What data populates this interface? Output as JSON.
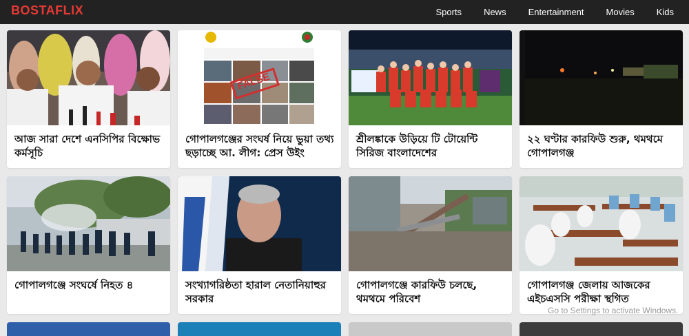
{
  "site": {
    "logo": "BOSTAFLIX"
  },
  "nav": {
    "items": [
      "Sports",
      "News",
      "Entertainment",
      "Movies",
      "Kids"
    ]
  },
  "cards": [
    {
      "title": "আজ সারা দেশে এনসিপির বিক্ষোভ কর্মসূচি",
      "image_icon": "press-conference-image"
    },
    {
      "title": "গোপালগঞ্জের সংঘর্ষ নিয়ে ভুয়া তথ্য ছড়াচ্ছে আ. লীগ: প্রেস উইং",
      "image_icon": "fact-check-image"
    },
    {
      "title": "শ্রীলঙ্কাকে উড়িয়ে টি টোয়েন্টি সিরিজ বাংলাদেশের",
      "image_icon": "cricket-team-image"
    },
    {
      "title": "২২ ঘণ্টার কারফিউ শুরু, থমথমে গোপালগঞ্জ",
      "image_icon": "night-street-image"
    },
    {
      "title": "গোপালগঞ্জে সংঘর্ষে নিহত ৪",
      "image_icon": "police-street-image"
    },
    {
      "title": "সংখ্যাগরিষ্ঠতা হারাল নেতানিয়াহুর সরকার",
      "image_icon": "portrait-flag-image"
    },
    {
      "title": "গোপালগঞ্জে কারফিউ চলছে, থমথমে পরিবেশ",
      "image_icon": "damaged-road-image"
    },
    {
      "title": "গোপালগঞ্জ জেলায় আজকের এইচএসসি পরীক্ষা স্থগিত",
      "image_icon": "exam-hall-image"
    }
  ],
  "fact_check_stamp": "FALSE",
  "os_watermark": "Go to Settings to activate Windows."
}
